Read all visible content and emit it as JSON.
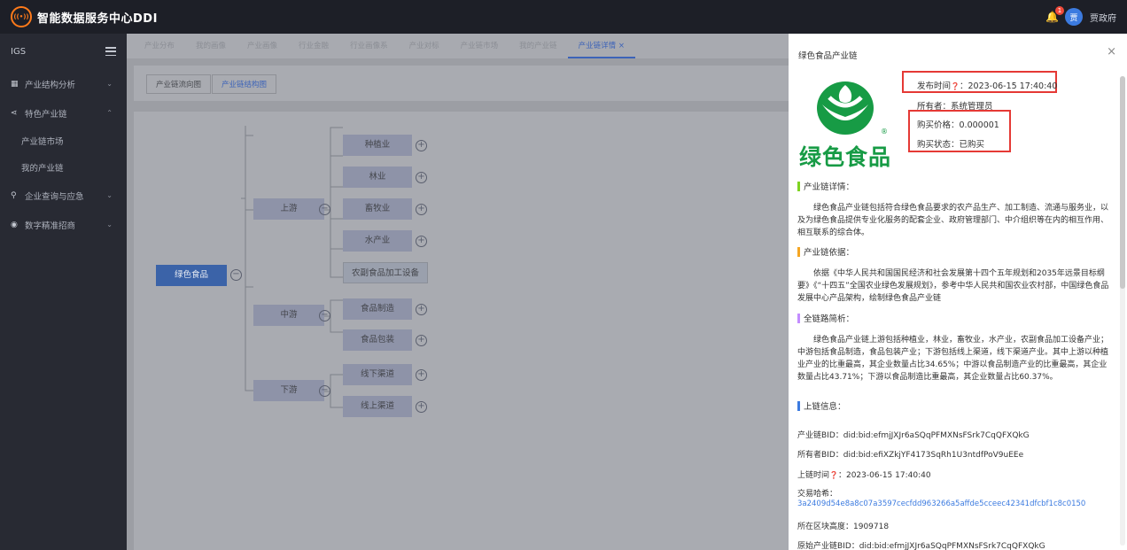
{
  "topbar": {
    "logo_glyph": "((•))",
    "app_title": "智能数据服务中心DDI",
    "notification_count": "1",
    "avatar_glyph": "贾",
    "user_name": "贾政府"
  },
  "sidebar": {
    "header": "IGS",
    "items": [
      {
        "label": "产业结构分析",
        "icon": "grid-icon",
        "glyph": "▦",
        "chevron": "⌄"
      },
      {
        "label": "特色产业链",
        "icon": "share-icon",
        "glyph": "⋖",
        "chevron": "⌃"
      },
      {
        "label": "企业查询与应急",
        "icon": "search-icon",
        "glyph": "⚲",
        "chevron": "⌄"
      },
      {
        "label": "数字精准招商",
        "icon": "target-icon",
        "glyph": "◉",
        "chevron": "⌄"
      }
    ],
    "subitems": [
      "产业链市场",
      "我的产业链"
    ]
  },
  "tabs": [
    {
      "label": "产业分布"
    },
    {
      "label": "我的画像"
    },
    {
      "label": "产业画像"
    },
    {
      "label": "行业金融"
    },
    {
      "label": "行业画像系"
    },
    {
      "label": "产业对标"
    },
    {
      "label": "产业链市场"
    },
    {
      "label": "我的产业链"
    },
    {
      "label": "产业链详情 ×",
      "active": true
    }
  ],
  "subtabs": [
    "产业链流向图",
    "产业链结构图"
  ],
  "mindmap": {
    "root": "绿色食品",
    "upstream": "上游",
    "midstream": "中游",
    "downstream": "下游",
    "up_children": [
      "种植业",
      "林业",
      "畜牧业",
      "水产业",
      "农副食品加工设备"
    ],
    "mid_children": [
      "食品制造",
      "食品包装"
    ],
    "down_children": [
      "线下渠道",
      "线上渠道"
    ],
    "plus": "+",
    "minus": "−"
  },
  "panel": {
    "title": "绿色食品产业链",
    "close": "×",
    "brand_text": "绿色食品",
    "brand_reg": "®",
    "publish_time_label": "发布时间",
    "help_glyph": "❓",
    "publish_time_value": "：2023-06-15 17:40:40",
    "owner": "所有者：系统管理员",
    "price": "购买价格：0.000001",
    "status": "购买状态：已购买",
    "sections": [
      {
        "title": "产业链详情：",
        "color": "#7ed321",
        "text": "绿色食品产业链包括符合绿色食品要求的农产品生产、加工制造、流通与服务业，以及为绿色食品提供专业化服务的配套企业、政府管理部门、中介组织等在内的相互作用、相互联系的综合体。"
      },
      {
        "title": "产业链依据：",
        "color": "#f5a623",
        "text": "依据《中华人民共和国国民经济和社会发展第十四个五年规划和2035年远景目标纲要》《“十四五”全国农业绿色发展规划》，参考中华人民共和国农业农村部，中国绿色食品发展中心产品架构，绘制绿色食品产业链"
      },
      {
        "title": "全链路简析：",
        "color": "#c38dff",
        "text": "绿色食品产业链上游包括种植业，林业，畜牧业，水产业，农副食品加工设备产业；中游包括食品制造，食品包装产业；下游包括线上渠道，线下渠道产业。其中上游以种植业产业的比重最高，其企业数量占比34.65%；中游以食品制造产业的比重最高，其企业数量占比43.71%；下游以食品制造比重最高，其企业数量占比60.37%。"
      }
    ],
    "chain_title": "上链信息：",
    "chain_color": "#3c7be0",
    "chain_bid": "产业链BID：did:bid:efmjJXJr6aSQqPFMXNsFSrk7CqQFXQkG",
    "owner_bid": "所有者BID：did:bid:efiXZkjYF4173SqRh1U3ntdfPoV9uEEe",
    "chain_time_label": "上链时间",
    "chain_time_value": "：2023-06-15 17:40:40",
    "tx_hash_label": "交易哈希：",
    "tx_hash_value": "3a2409d54e8a8c07a3597cecfdd963266a5affde5cceec42341dfcbf1c8c0150",
    "block_height": "所在区块高度：1909718",
    "origin_bid": "原始产业链BID：did:bid:efmjJXJr6aSQqPFMXNsFSrk7CqQFXQkG"
  }
}
